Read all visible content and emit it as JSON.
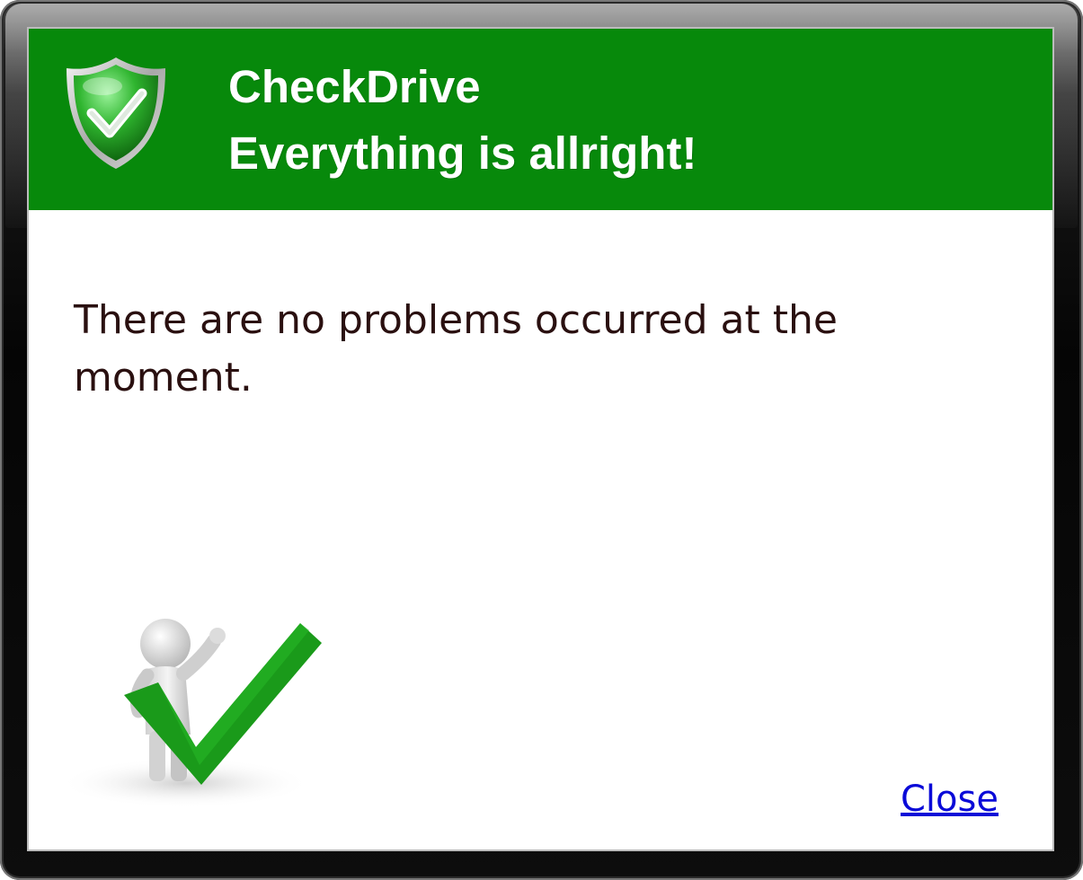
{
  "header": {
    "title": "CheckDrive",
    "subtitle": "Everything is allright!",
    "background_color": "#07890b",
    "icon": "shield-check-icon"
  },
  "body": {
    "message": "There are no problems occurred at the moment.",
    "illustration": "person-with-checkmark-illustration"
  },
  "actions": {
    "close_label": "Close"
  }
}
